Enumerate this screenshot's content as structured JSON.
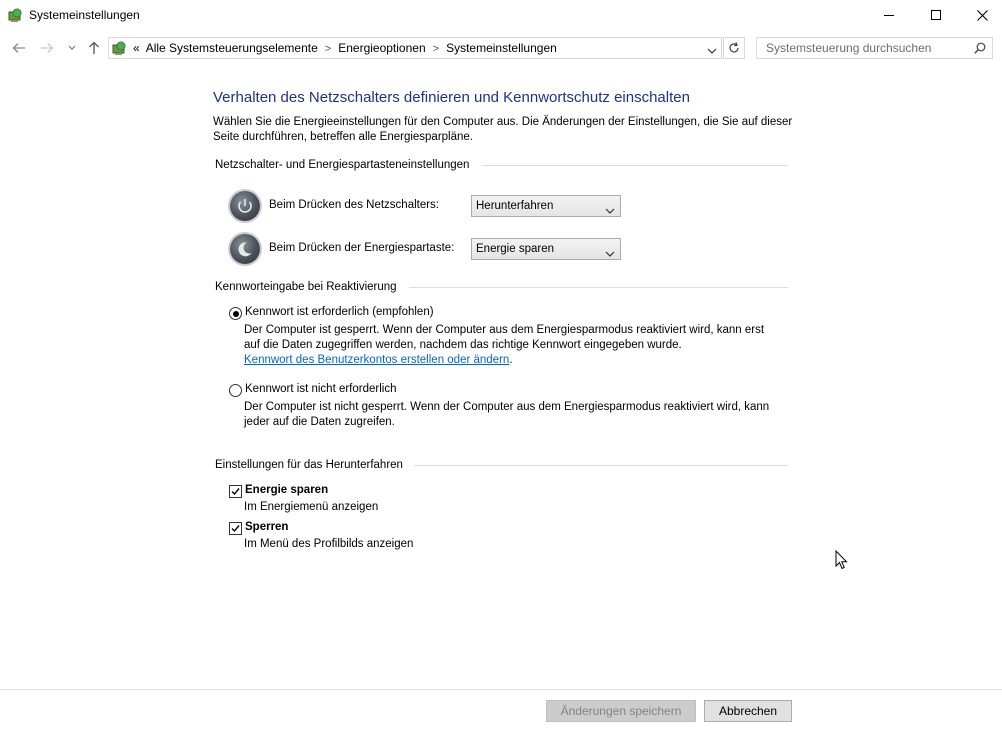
{
  "window": {
    "title": "Systemeinstellungen"
  },
  "nav": {
    "breadcrumb_prefix": "«",
    "breadcrumbs": [
      "Alle Systemsteuerungselemente",
      "Energieoptionen",
      "Systemeinstellungen"
    ],
    "search_placeholder": "Systemsteuerung durchsuchen"
  },
  "main": {
    "heading": "Verhalten des Netzschalters definieren und Kennwortschutz einschalten",
    "description": "Wählen Sie die Energieeinstellungen für den Computer aus. Die Änderungen der Einstellungen, die Sie auf dieser Seite durchführen, betreffen alle Energiesparpläne.",
    "power_section": {
      "title": "Netzschalter- und Energiespartasteneinstellungen",
      "rows": [
        {
          "label": "Beim Drücken des Netzschalters:",
          "value": "Herunterfahren"
        },
        {
          "label": "Beim Drücken der Energiespartaste:",
          "value": "Energie sparen"
        }
      ]
    },
    "password_section": {
      "title": "Kennworteingabe bei Reaktivierung",
      "option1_title": "Kennwort ist erforderlich (empfohlen)",
      "option1_desc": "Der Computer ist gesperrt. Wenn der Computer aus dem Energiesparmodus reaktiviert wird, kann erst auf die Daten zugegriffen werden, nachdem das richtige Kennwort eingegeben wurde.",
      "option1_link": "Kennwort des Benutzerkontos erstellen oder ändern",
      "option1_link_suffix": ".",
      "option1_selected": true,
      "option2_title": "Kennwort ist nicht erforderlich",
      "option2_desc": "Der Computer ist nicht gesperrt. Wenn der Computer aus dem Energiesparmodus reaktiviert wird, kann jeder auf die Daten zugreifen.",
      "option2_selected": false
    },
    "shutdown_section": {
      "title": "Einstellungen für das Herunterfahren",
      "items": [
        {
          "title": "Energie sparen",
          "subtitle": "Im Energiemenü anzeigen",
          "checked": true
        },
        {
          "title": "Sperren",
          "subtitle": "Im Menü des Profilbilds anzeigen",
          "checked": true
        }
      ]
    }
  },
  "footer": {
    "save_label": "Änderungen speichern",
    "cancel_label": "Abbrechen"
  },
  "colors": {
    "heading": "#1e3287",
    "link": "#0066cc"
  }
}
